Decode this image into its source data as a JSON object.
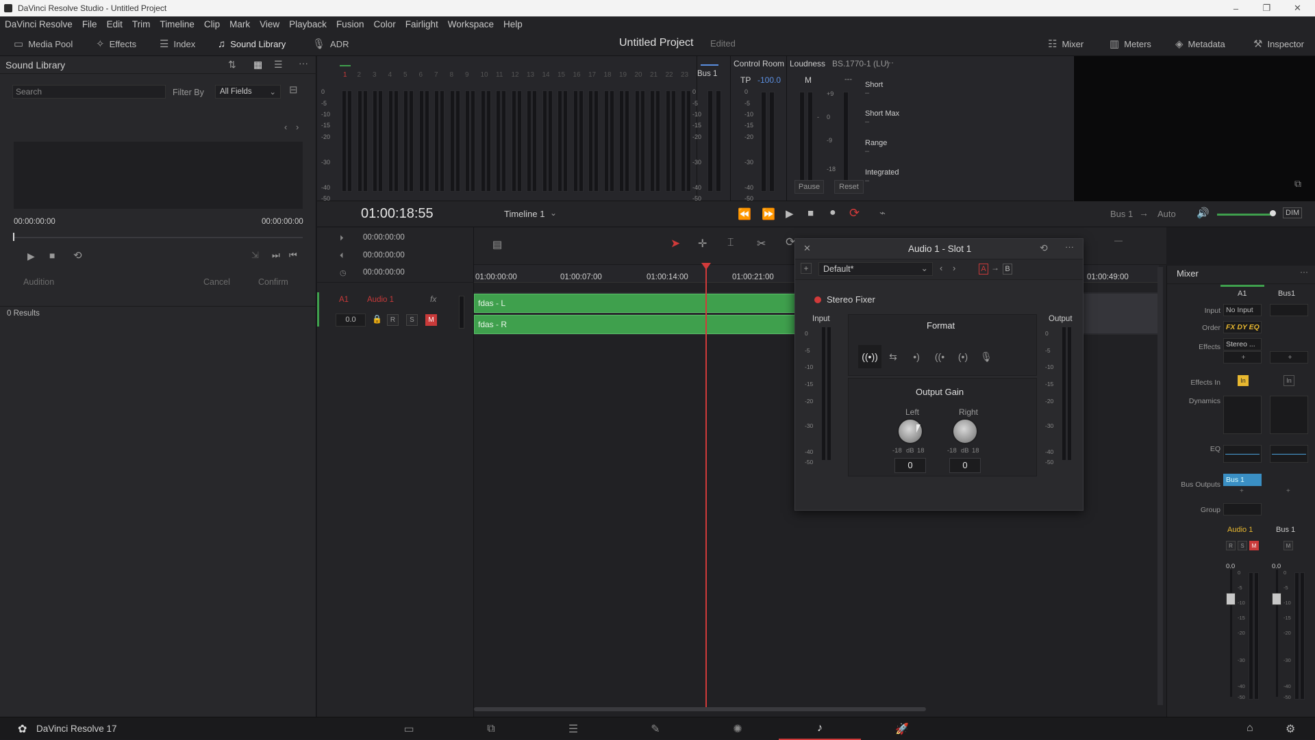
{
  "window": {
    "title": "DaVinci Resolve Studio - Untitled Project",
    "minimize": "–",
    "maximize": "❐",
    "close": "✕"
  },
  "menu": [
    "DaVinci Resolve",
    "File",
    "Edit",
    "Trim",
    "Timeline",
    "Clip",
    "Mark",
    "View",
    "Playback",
    "Fusion",
    "Color",
    "Fairlight",
    "Workspace",
    "Help"
  ],
  "toolbar": {
    "media_pool": "Media Pool",
    "effects": "Effects",
    "index": "Index",
    "sound_library": "Sound Library",
    "adr": "ADR",
    "project": "Untitled Project",
    "edited": "Edited",
    "mixer": "Mixer",
    "meters": "Meters",
    "metadata": "Metadata",
    "inspector": "Inspector"
  },
  "sound_library": {
    "title": "Sound Library",
    "search_placeholder": "Search",
    "filter_by": "Filter By",
    "filter_value": "All Fields",
    "time_start": "00:00:00:00",
    "time_end": "00:00:00:00",
    "audition": "Audition",
    "cancel": "Cancel",
    "confirm": "Confirm",
    "results": "0 Results"
  },
  "meters": {
    "channel_numbers": [
      "1",
      "2",
      "3",
      "4",
      "5",
      "6",
      "7",
      "8",
      "9",
      "10",
      "11",
      "12",
      "13",
      "14",
      "15",
      "16",
      "17",
      "18",
      "19",
      "20",
      "21",
      "22",
      "23"
    ],
    "scale": [
      "0",
      "-5",
      "-10",
      "-15",
      "-20",
      "-30",
      "-40",
      "-50"
    ],
    "bus1": "Bus 1",
    "control_room": "Control Room",
    "tp_label": "TP",
    "tp_value": "-100.0",
    "loudness": "Loudness",
    "loudness_std": "BS.1770-1 (LU)",
    "m_label": "M",
    "m_dash": "---",
    "lu_scale": [
      "+9",
      "0",
      "-9",
      "-18"
    ],
    "short": "Short",
    "short_max": "Short Max",
    "range": "Range",
    "integrated": "Integrated",
    "dash": "–",
    "pause": "Pause",
    "reset": "Reset"
  },
  "transport": {
    "timecode": "01:00:18:55",
    "timeline": "Timeline 1",
    "bus": "Bus 1",
    "arrow": "→",
    "auto": "Auto",
    "dim": "DIM"
  },
  "timeline": {
    "tc_rows": [
      "00:00:00:00",
      "00:00:00:00",
      "00:00:00:00"
    ],
    "track_id": "A1",
    "track_name": "Audio 1",
    "fx": "fx",
    "volume": "0.0",
    "r": "R",
    "s": "S",
    "m": "M",
    "ruler": [
      "01:00:00:00",
      "01:00:07:00",
      "01:00:14:00",
      "01:00:21:00",
      "01:00:49:00"
    ],
    "clip_l": "fdas - L",
    "clip_r": "fdas - R"
  },
  "plugin": {
    "title": "Audio 1 - Slot 1",
    "preset": "Default*",
    "a": "A",
    "arrow": "→",
    "b": "B",
    "plugin_name": "Stereo Fixer",
    "input": "Input",
    "output": "Output",
    "format": "Format",
    "output_gain": "Output Gain",
    "left": "Left",
    "right": "Right",
    "knob_scale": [
      "-18",
      "dB",
      "18"
    ],
    "left_value": "0",
    "right_value": "0",
    "scale": [
      "0",
      "-5",
      "-10",
      "-15",
      "-20",
      "-30",
      "-40",
      "-50"
    ]
  },
  "mixer": {
    "title": "Mixer",
    "col_a1": "A1",
    "col_bus1": "Bus1",
    "rows": {
      "input": "Input",
      "order": "Order",
      "effects": "Effects",
      "effects_in": "Effects In",
      "dynamics": "Dynamics",
      "eq": "EQ",
      "bus_outputs": "Bus Outputs",
      "group": "Group"
    },
    "no_input": "No Input",
    "order_value": "FX DY EQ",
    "effect_slot": "Stereo ...",
    "plus": "+",
    "effects_in_btn": "In",
    "bus_output": "Bus 1",
    "strip_audio1": "Audio 1",
    "strip_bus1": "Bus 1",
    "fader_a": "0.0",
    "fader_b": "0.0",
    "fader_scale": [
      "0",
      "-5",
      "-10",
      "-15",
      "-20",
      "-30",
      "-40",
      "-50"
    ]
  },
  "bottom": {
    "app_name": "DaVinci Resolve 17"
  },
  "colors": {
    "accent_green": "#3fa04d",
    "playhead": "#d13a3a",
    "mute_red": "#c93a3a",
    "tp_blue": "#5b8fe0"
  }
}
